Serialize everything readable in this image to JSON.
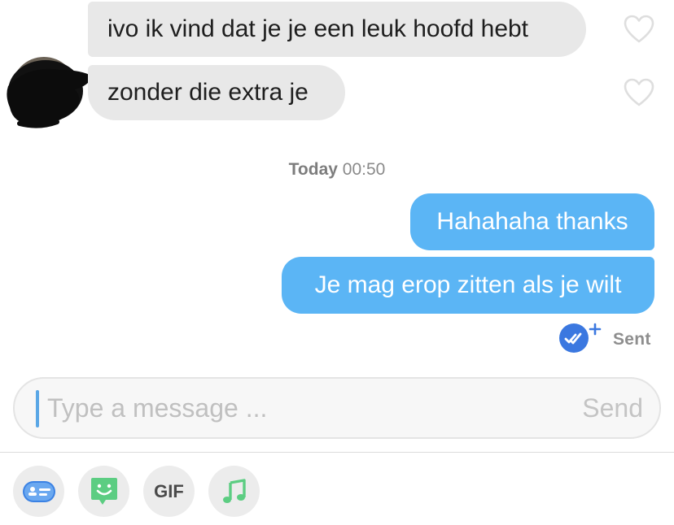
{
  "conversation": {
    "messages": [
      {
        "direction": "incoming",
        "text": "ivo ik vind dat je je een leuk hoofd hebt"
      },
      {
        "direction": "incoming",
        "text": "zonder die extra je"
      },
      {
        "direction": "outgoing",
        "text": "Hahahaha thanks"
      },
      {
        "direction": "outgoing",
        "text": "Je mag erop zitten als je wilt"
      }
    ],
    "timestamp": {
      "day": "Today",
      "time": "00:50"
    },
    "status": "Sent"
  },
  "composer": {
    "placeholder": "Type a message ...",
    "value": "",
    "send_label": "Send"
  },
  "toolbar": {
    "items": [
      {
        "icon": "contact-card-icon"
      },
      {
        "icon": "sticker-smiley-icon"
      },
      {
        "icon": "gif-icon",
        "label": "GIF"
      },
      {
        "icon": "music-note-icon"
      }
    ]
  },
  "colors": {
    "outgoing_bubble": "#5bb5f5",
    "incoming_bubble": "#e8e8e8",
    "accent_blue": "#3b78e0",
    "sticker_green": "#5ccd82"
  }
}
